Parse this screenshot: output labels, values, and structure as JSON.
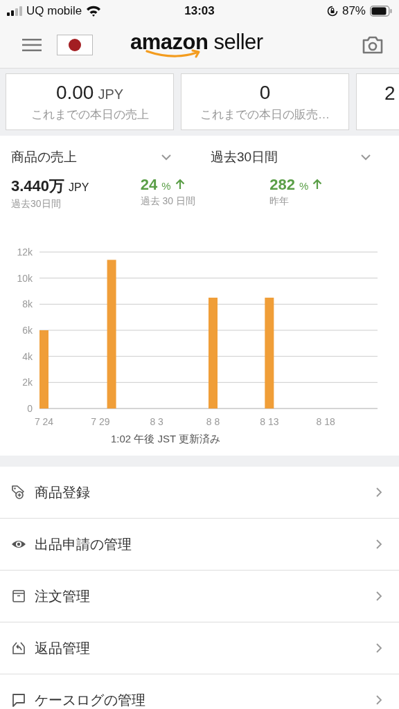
{
  "status_bar": {
    "carrier": "UQ mobile",
    "time": "13:03",
    "battery": "87%"
  },
  "header": {
    "logo": "**amazon** seller"
  },
  "summary_cards": [
    {
      "value": "0.00",
      "unit": "JPY",
      "label": "これまでの本日の売上"
    },
    {
      "value": "0",
      "label": "これまでの本日の販売…"
    },
    {
      "value": "2"
    }
  ],
  "sales": {
    "metric": "商品の売上",
    "period": "過去30日間",
    "stats": [
      {
        "kind": "total",
        "value": "3.440万",
        "unit": "JPY",
        "caption": "過去30日間"
      },
      {
        "kind": "growth",
        "value": "24",
        "unit": "%",
        "caption": "過去 30 日間"
      },
      {
        "kind": "growth",
        "value": "282",
        "unit": "%",
        "caption": "昨年"
      }
    ],
    "chart_data": {
      "type": "bar",
      "categories": [
        "7 24",
        null,
        null,
        null,
        null,
        "7 29",
        null,
        null,
        null,
        null,
        "8 3",
        null,
        null,
        null,
        null,
        "8 8",
        null,
        null,
        null,
        null,
        "8 13",
        null,
        null,
        null,
        null,
        "8 18",
        null,
        null,
        null,
        null
      ],
      "grid": true,
      "series": [
        {
          "color": "#f09e38",
          "values": [
            6000,
            0,
            0,
            0,
            0,
            0,
            11400,
            0,
            0,
            0,
            0,
            0,
            0,
            0,
            0,
            8500,
            0,
            0,
            0,
            0,
            8500,
            0,
            0,
            0,
            0,
            0,
            0,
            0,
            0,
            0
          ]
        }
      ],
      "ylim": [
        0,
        12000
      ],
      "yticks": [
        {
          "value": 0,
          "label": "0"
        },
        {
          "value": 2000,
          "label": "2k"
        },
        {
          "value": 4000,
          "label": "4k"
        },
        {
          "value": 6000,
          "label": "6k"
        },
        {
          "value": 8000,
          "label": "8k"
        },
        {
          "value": 10000,
          "label": "10k"
        },
        {
          "value": 12000,
          "label": "12k"
        }
      ]
    },
    "updated": "1:02 午後 JST 更新済み"
  },
  "menu": [
    {
      "label": "商品登録"
    },
    {
      "label": "出品申請の管理"
    },
    {
      "label": "注文管理"
    },
    {
      "label": "返品管理"
    },
    {
      "label": "ケースログの管理"
    }
  ]
}
